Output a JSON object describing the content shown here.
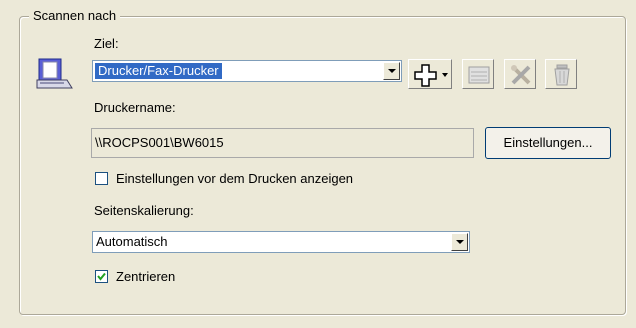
{
  "group": {
    "title": "Scannen nach"
  },
  "target": {
    "label": "Ziel:",
    "selected": "Drucker/Fax-Drucker"
  },
  "toolbar": {
    "add_icon": "add-icon",
    "disabled_icons": [
      "scanner-list-icon",
      "tools-icon",
      "trash-icon"
    ]
  },
  "printer": {
    "label": "Druckername:",
    "value": "\\\\ROCPS001\\BW6015",
    "settings_button": "Einstellungen..."
  },
  "show_settings": {
    "label": "Einstellungen vor dem Drucken anzeigen",
    "checked": false
  },
  "scaling": {
    "label": "Seitenskalierung:",
    "selected": "Automatisch"
  },
  "center": {
    "label": "Zentrieren",
    "checked": true
  }
}
